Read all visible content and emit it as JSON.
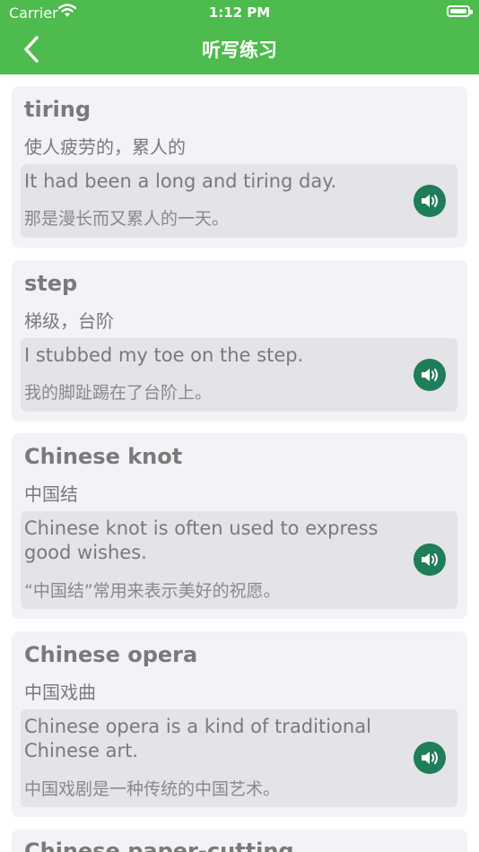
{
  "status_bar": {
    "carrier": "Carrier",
    "time": "1:12 PM"
  },
  "nav": {
    "title": "听写练习"
  },
  "entries": [
    {
      "word": "tiring",
      "meaning": "使人疲劳的，累人的",
      "example_en": "It had been a long and tiring day.",
      "example_zh": "那是漫长而又累人的一天。"
    },
    {
      "word": "step",
      "meaning": "梯级，台阶",
      "example_en": "I stubbed my toe on the step.",
      "example_zh": "我的脚趾踢在了台阶上。"
    },
    {
      "word": "Chinese knot",
      "meaning": "中国结",
      "example_en": "Chinese knot is often used to express good wishes.",
      "example_zh": "“中国结”常用来表示美好的祝愿。"
    },
    {
      "word": "Chinese opera",
      "meaning": "中国戏曲",
      "example_en": "Chinese opera is a kind of traditional Chinese art.",
      "example_zh": "中国戏剧是一种传统的中国艺术。"
    },
    {
      "word": "Chinese paper-cutting"
    }
  ],
  "colors": {
    "accent": "#4dbb4d",
    "speaker": "#1f7d5a"
  },
  "icons": {
    "back": "chevron-left-icon",
    "speaker": "speaker-icon",
    "wifi": "wifi-icon",
    "battery": "battery-icon"
  }
}
